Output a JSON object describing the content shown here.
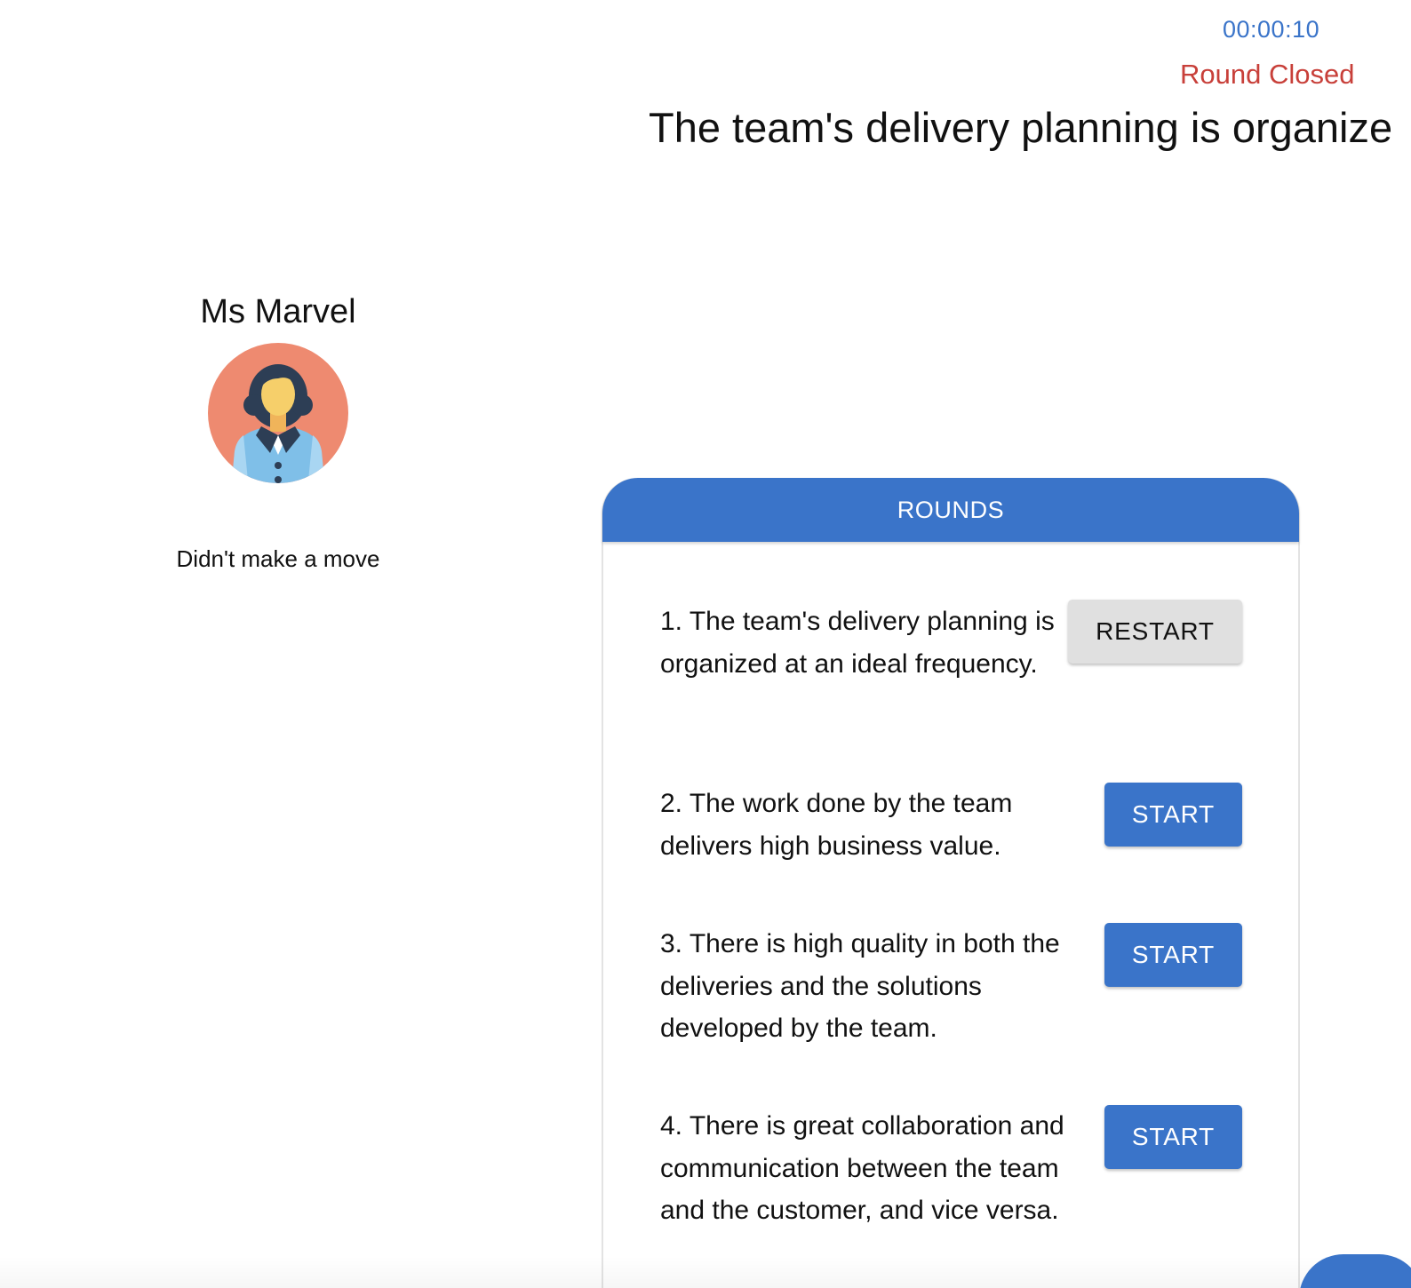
{
  "timer": "00:00:10",
  "round_status": "Round Closed",
  "current_question": "The team's delivery planning is organize",
  "player": {
    "name": "Ms Marvel",
    "avatar_icon": "woman-avatar-icon",
    "status": "Didn't make a move"
  },
  "rounds": {
    "header": "ROUNDS",
    "items": [
      {
        "text": "1. The team's delivery planning is organized at an ideal frequency.",
        "button": "RESTART"
      },
      {
        "text": "2. The work done by the team delivers high business value.",
        "button": "START"
      },
      {
        "text": "3. There is high quality in both the deliveries and the solutions developed by the team.",
        "button": "START"
      },
      {
        "text": "4. There is great collaboration and communication between the team and the customer, and vice versa.",
        "button": "START"
      }
    ]
  },
  "colors": {
    "accent": "#3a74c9",
    "status_closed": "#c8403a",
    "restart_button": "#e0e0e0"
  }
}
